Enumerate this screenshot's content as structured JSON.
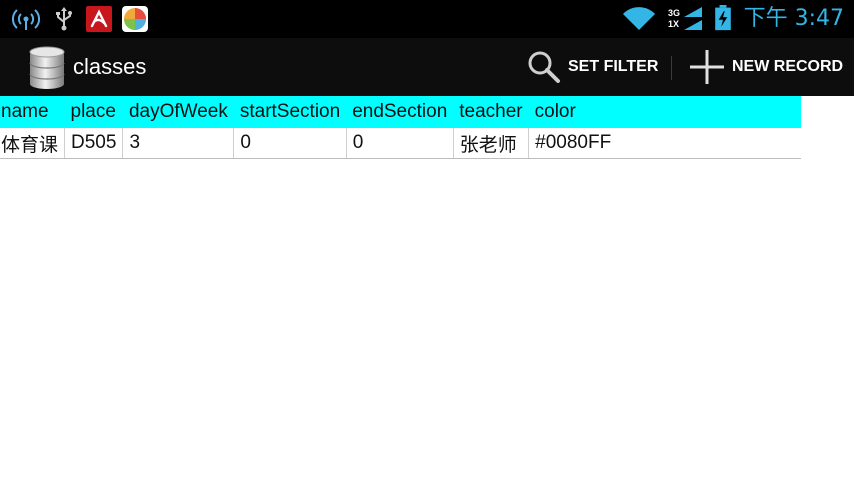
{
  "status_bar": {
    "time": "下午 3:47",
    "network": {
      "line1": "3G",
      "line2": "1X"
    },
    "icons": [
      "wifi-tethering-icon",
      "usb-icon",
      "avira-app-icon",
      "colorful-app-icon",
      "wifi-signal-icon",
      "cell-signal-icon",
      "battery-charging-icon"
    ],
    "accent_color": "#33b5e5"
  },
  "action_bar": {
    "title": "classes",
    "app_icon": "database-icon",
    "set_filter": {
      "label": "SET FILTER",
      "icon": "search-icon"
    },
    "new_record": {
      "label": "NEW RECORD",
      "icon": "plus-icon"
    }
  },
  "table": {
    "header_color": "#00ffff",
    "columns": [
      "name",
      "place",
      "dayOfWeek",
      "startSection",
      "endSection",
      "teacher",
      "color"
    ],
    "rows": [
      [
        "体育课",
        "D505",
        "3",
        "0",
        "0",
        "张老师",
        "#0080FF"
      ]
    ]
  }
}
